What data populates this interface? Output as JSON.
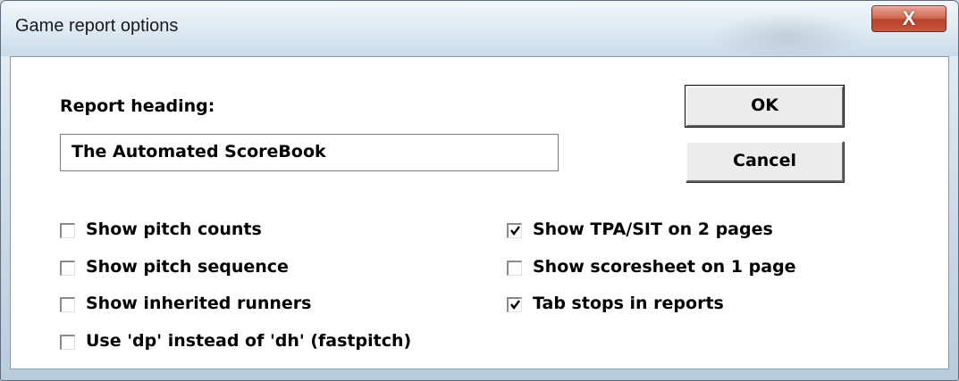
{
  "window": {
    "title": "Game report options",
    "close_label": "X"
  },
  "form": {
    "heading_label": "Report heading:",
    "heading_value": "The Automated ScoreBook"
  },
  "buttons": {
    "ok": "OK",
    "cancel": "Cancel"
  },
  "options_left": [
    {
      "label": "Show pitch counts",
      "checked": false
    },
    {
      "label": "Show pitch sequence",
      "checked": false
    },
    {
      "label": "Show inherited runners",
      "checked": false
    },
    {
      "label": "Use 'dp' instead of 'dh' (fastpitch)",
      "checked": false
    }
  ],
  "options_right": [
    {
      "label": "Show TPA/SIT on 2 pages",
      "checked": true
    },
    {
      "label": "Show scoresheet on 1 page",
      "checked": false
    },
    {
      "label": "Tab stops in reports",
      "checked": true
    }
  ]
}
